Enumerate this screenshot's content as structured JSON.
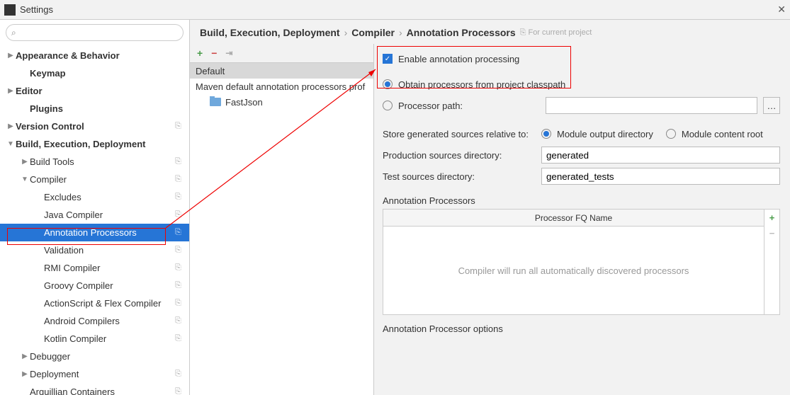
{
  "title": "Settings",
  "breadcrumb": {
    "b1": "Build, Execution, Deployment",
    "b2": "Compiler",
    "b3": "Annotation Processors",
    "badge": "For current project"
  },
  "sidebar": {
    "search_placeholder": "",
    "items": [
      {
        "label": "Appearance & Behavior",
        "lvl": 0,
        "arrow": "▶",
        "bold": true,
        "copy": false
      },
      {
        "label": "Keymap",
        "lvl": 1,
        "arrow": "",
        "bold": true,
        "copy": false
      },
      {
        "label": "Editor",
        "lvl": 0,
        "arrow": "▶",
        "bold": true,
        "copy": false
      },
      {
        "label": "Plugins",
        "lvl": 1,
        "arrow": "",
        "bold": true,
        "copy": false
      },
      {
        "label": "Version Control",
        "lvl": 0,
        "arrow": "▶",
        "bold": true,
        "copy": true
      },
      {
        "label": "Build, Execution, Deployment",
        "lvl": 0,
        "arrow": "▼",
        "bold": true,
        "copy": false
      },
      {
        "label": "Build Tools",
        "lvl": 1,
        "arrow": "▶",
        "bold": false,
        "copy": true
      },
      {
        "label": "Compiler",
        "lvl": 1,
        "arrow": "▼",
        "bold": false,
        "copy": true
      },
      {
        "label": "Excludes",
        "lvl": 2,
        "arrow": "",
        "bold": false,
        "copy": true
      },
      {
        "label": "Java Compiler",
        "lvl": 2,
        "arrow": "",
        "bold": false,
        "copy": true
      },
      {
        "label": "Annotation Processors",
        "lvl": 2,
        "arrow": "",
        "bold": false,
        "copy": true,
        "selected": true
      },
      {
        "label": "Validation",
        "lvl": 2,
        "arrow": "",
        "bold": false,
        "copy": true
      },
      {
        "label": "RMI Compiler",
        "lvl": 2,
        "arrow": "",
        "bold": false,
        "copy": true
      },
      {
        "label": "Groovy Compiler",
        "lvl": 2,
        "arrow": "",
        "bold": false,
        "copy": true
      },
      {
        "label": "ActionScript & Flex Compiler",
        "lvl": 2,
        "arrow": "",
        "bold": false,
        "copy": true
      },
      {
        "label": "Android Compilers",
        "lvl": 2,
        "arrow": "",
        "bold": false,
        "copy": true
      },
      {
        "label": "Kotlin Compiler",
        "lvl": 2,
        "arrow": "",
        "bold": false,
        "copy": true
      },
      {
        "label": "Debugger",
        "lvl": 1,
        "arrow": "▶",
        "bold": false,
        "copy": false
      },
      {
        "label": "Deployment",
        "lvl": 1,
        "arrow": "▶",
        "bold": false,
        "copy": true
      },
      {
        "label": "Arquillian Containers",
        "lvl": 1,
        "arrow": "",
        "bold": false,
        "copy": true
      }
    ]
  },
  "profiles": {
    "default_label": "Default",
    "maven_label": "Maven default annotation processors prof",
    "module_label": "FastJson"
  },
  "form": {
    "enable_label": "Enable annotation processing",
    "obtain_label": "Obtain processors from project classpath",
    "path_label": "Processor path:",
    "store_label": "Store generated sources relative to:",
    "module_output": "Module output directory",
    "module_content": "Module content root",
    "prod_label": "Production sources directory:",
    "prod_value": "generated",
    "test_label": "Test sources directory:",
    "test_value": "generated_tests",
    "section_ap": "Annotation Processors",
    "fq_header": "Processor FQ Name",
    "fq_empty": "Compiler will run all automatically discovered processors",
    "section_options": "Annotation Processor options"
  }
}
